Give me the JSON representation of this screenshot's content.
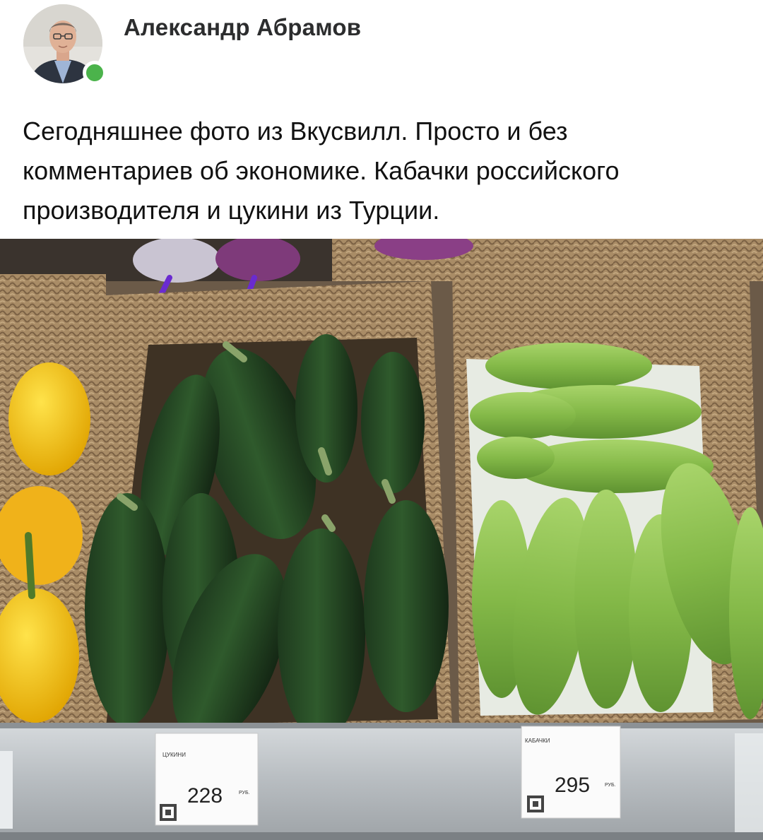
{
  "author": {
    "name": "Александр Абрамов",
    "online": true
  },
  "post": {
    "text": "Сегодняшнее фото из Вкусвилл. Просто и без комментариев об экономике. Кабачки российского производителя и цукини из Турции."
  },
  "photo": {
    "price_tags": [
      {
        "product": "ЦУКИНИ",
        "price": "228",
        "currency": "РУБ."
      },
      {
        "product": "КАБАЧКИ",
        "price": "295",
        "currency": "РУБ."
      }
    ]
  },
  "colors": {
    "online": "#4bb34b",
    "text": "#111111",
    "author": "#2c2d2e"
  }
}
